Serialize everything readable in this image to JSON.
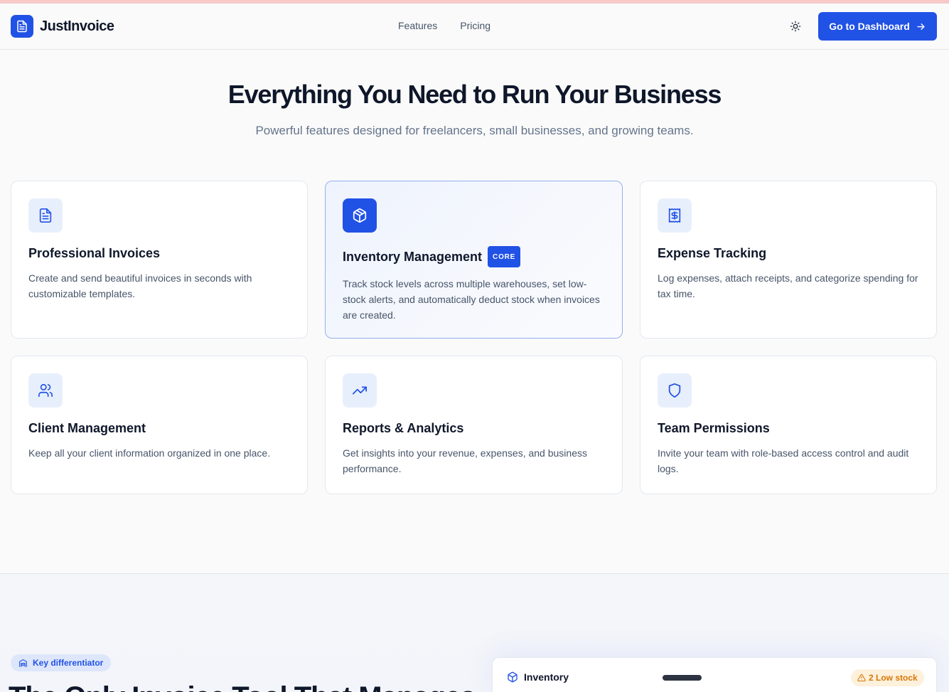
{
  "nav": {
    "brand": "JustInvoice",
    "links": [
      "Features",
      "Pricing"
    ],
    "cta_label": "Go to Dashboard"
  },
  "hero": {
    "title": "Everything You Need to Run Your Business",
    "subtitle": "Powerful features designed for freelancers, small businesses, and growing teams."
  },
  "features": [
    {
      "title": "Professional Invoices",
      "description": "Create and send beautiful invoices in seconds with customizable templates.",
      "icon": "document-icon"
    },
    {
      "title": "Inventory Management",
      "badge": "CORE",
      "description": "Track stock levels across multiple warehouses, set low-stock alerts, and automatically deduct stock when invoices are created.",
      "icon": "package-icon"
    },
    {
      "title": "Expense Tracking",
      "description": "Log expenses, attach receipts, and categorize spending for tax time.",
      "icon": "receipt-icon"
    },
    {
      "title": "Client Management",
      "description": "Keep all your client information organized in one place.",
      "icon": "users-icon"
    },
    {
      "title": "Reports & Analytics",
      "description": "Get insights into your revenue, expenses, and business performance.",
      "icon": "trending-up-icon"
    },
    {
      "title": "Team Permissions",
      "description": "Invite your team with role-based access control and audit logs.",
      "icon": "shield-icon"
    }
  ],
  "lower": {
    "pill_label": "Key differentiator",
    "heading_partial": "The Only Invoice Tool That Manages",
    "inventory_card": {
      "title": "Inventory",
      "alert": "2 Low stock"
    }
  },
  "colors": {
    "accent": "#2152e6",
    "warning": "#d97706"
  }
}
